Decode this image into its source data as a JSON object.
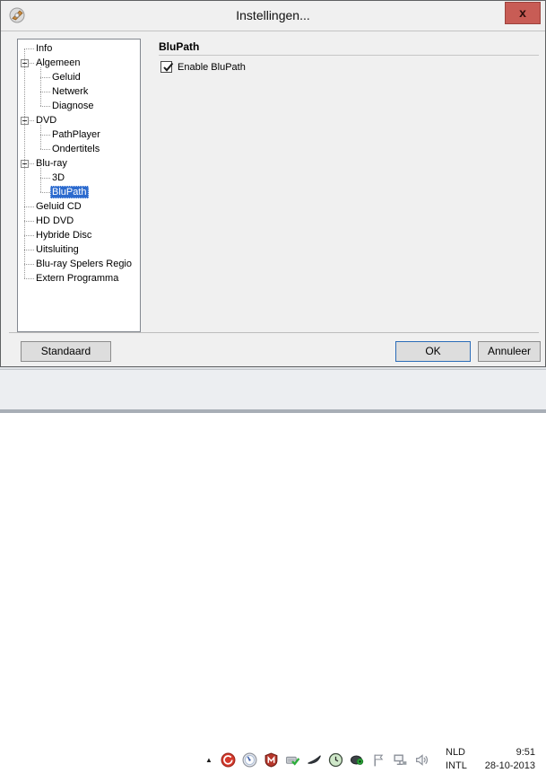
{
  "window": {
    "title": "Instellingen...",
    "icon": "app-disc-icon",
    "close_label": "x"
  },
  "tree": {
    "items": [
      {
        "label": "Info",
        "level": 0
      },
      {
        "label": "Algemeen",
        "level": 0,
        "expanded": true
      },
      {
        "label": "Geluid",
        "level": 1
      },
      {
        "label": "Netwerk",
        "level": 1
      },
      {
        "label": "Diagnose",
        "level": 1
      },
      {
        "label": "DVD",
        "level": 0,
        "expanded": true
      },
      {
        "label": "PathPlayer",
        "level": 1
      },
      {
        "label": "Ondertitels",
        "level": 1
      },
      {
        "label": "Blu-ray",
        "level": 0,
        "expanded": true
      },
      {
        "label": "3D",
        "level": 1
      },
      {
        "label": "BluPath",
        "level": 1,
        "selected": true
      },
      {
        "label": "Geluid CD",
        "level": 0
      },
      {
        "label": "HD DVD",
        "level": 0
      },
      {
        "label": "Hybride Disc",
        "level": 0
      },
      {
        "label": "Uitsluiting",
        "level": 0
      },
      {
        "label": "Blu-ray Spelers Regio",
        "level": 0
      },
      {
        "label": "Extern Programma",
        "level": 0
      }
    ]
  },
  "panel": {
    "header": "BluPath",
    "checkbox_label": "Enable BluPath",
    "checkbox_checked": true
  },
  "buttons": {
    "standaard": "Standaard",
    "ok": "OK",
    "annuleer": "Annuleer"
  },
  "taskbar": {
    "overflow_icon": "hidden-icons-arrow-icon",
    "tray_icons": [
      "red-swirl-icon",
      "gauge-icon",
      "mcafee-shield-icon",
      "device-check-icon",
      "dark-wing-icon",
      "green-clock-icon",
      "webcam-icon",
      "actioncenter-flag-icon",
      "network-icon",
      "volume-icon"
    ],
    "language": {
      "line1": "NLD",
      "line2": "INTL"
    },
    "clock": {
      "time": "9:51",
      "date": "28-10-2013"
    }
  },
  "colors": {
    "selection": "#2d6bce",
    "close_button": "#c85c55",
    "dialog_bg": "#f0f0f0",
    "ok_border": "#2b6cb8"
  }
}
